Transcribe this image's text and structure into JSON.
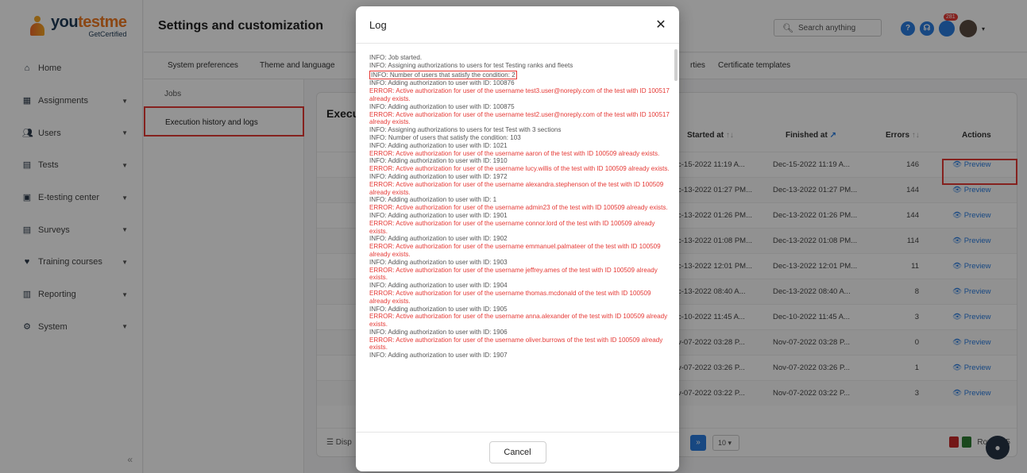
{
  "logo": {
    "name_main_a": "you",
    "name_main_b": "testme",
    "tagline": "GetCertified"
  },
  "sidebar": {
    "items": [
      {
        "label": "Home",
        "icon": "home-icon",
        "expandable": false
      },
      {
        "label": "Assignments",
        "icon": "assignments-icon",
        "expandable": true
      },
      {
        "label": "Users",
        "icon": "users-icon",
        "expandable": true
      },
      {
        "label": "Tests",
        "icon": "tests-icon",
        "expandable": true
      },
      {
        "label": "E-testing center",
        "icon": "e-testing-icon",
        "expandable": true
      },
      {
        "label": "Surveys",
        "icon": "surveys-icon",
        "expandable": true
      },
      {
        "label": "Training courses",
        "icon": "training-icon",
        "expandable": true
      },
      {
        "label": "Reporting",
        "icon": "reporting-icon",
        "expandable": true
      },
      {
        "label": "System",
        "icon": "gear-icon",
        "expandable": true
      }
    ],
    "collapse_glyph": "«"
  },
  "header": {
    "title": "Settings and customization",
    "search_placeholder": "Search anything",
    "notification_count": "281"
  },
  "subnav": {
    "tabs": [
      "System preferences",
      "Theme and language",
      "rties",
      "Certificate templates"
    ]
  },
  "left_menu": {
    "jobs": "Jobs",
    "selected": "Execution history and logs"
  },
  "table": {
    "title": "Execu",
    "columns": {
      "started": "Started at",
      "finished": "Finished at",
      "errors": "Errors",
      "actions": "Actions"
    },
    "rows": [
      {
        "started": "c-15-2022 11:19 A...",
        "finished": "Dec-15-2022 11:19 A...",
        "errors": "146",
        "action": "Preview"
      },
      {
        "started": "c-13-2022 01:27 PM...",
        "finished": "Dec-13-2022 01:27 PM...",
        "errors": "144",
        "action": "Preview"
      },
      {
        "started": "c-13-2022 01:26 PM...",
        "finished": "Dec-13-2022 01:26 PM...",
        "errors": "144",
        "action": "Preview"
      },
      {
        "started": "c-13-2022 01:08 PM...",
        "finished": "Dec-13-2022 01:08 PM...",
        "errors": "114",
        "action": "Preview"
      },
      {
        "started": "c-13-2022 12:01 PM...",
        "finished": "Dec-13-2022 12:01 PM...",
        "errors": "11",
        "action": "Preview"
      },
      {
        "started": "c-13-2022 08:40 A...",
        "finished": "Dec-13-2022 08:40 A...",
        "errors": "8",
        "action": "Preview"
      },
      {
        "started": "c-10-2022 11:45 A...",
        "finished": "Dec-10-2022 11:45 A...",
        "errors": "3",
        "action": "Preview"
      },
      {
        "started": "v-07-2022 03:28 P...",
        "finished": "Nov-07-2022 03:28 P...",
        "errors": "0",
        "action": "Preview"
      },
      {
        "started": "v-07-2022 03:26 P...",
        "finished": "Nov-07-2022 03:26 P...",
        "errors": "1",
        "action": "Preview"
      },
      {
        "started": "v-07-2022 03:22 P...",
        "finished": "Nov-07-2022 03:22 P...",
        "errors": "3",
        "action": "Preview"
      }
    ],
    "footer": {
      "display_prefix": "Disp",
      "page_size": "10",
      "rows_label": "Rows: 15"
    }
  },
  "modal": {
    "title": "Log",
    "cancel_label": "Cancel",
    "lines": [
      {
        "type": "info",
        "text": "INFO: Job started."
      },
      {
        "type": "info",
        "text": "INFO: Assigning authorizations to users for test Testing ranks and fleets"
      },
      {
        "type": "info",
        "text": "INFO: Number of users that satisfy the condition: 2",
        "highlight": true
      },
      {
        "type": "info",
        "text": "INFO: Adding authorization to user with ID: 100876"
      },
      {
        "type": "error",
        "text": "ERROR: Active authorization for user of the username test3.user@noreply.com of the test with ID 100517 already exists."
      },
      {
        "type": "info",
        "text": "INFO: Adding authorization to user with ID: 100875"
      },
      {
        "type": "error",
        "text": "ERROR: Active authorization for user of the username test2.user@noreply.com of the test with ID 100517 already exists."
      },
      {
        "type": "info",
        "text": "INFO: Assigning authorizations to users for test Test with 3 sections"
      },
      {
        "type": "info",
        "text": "INFO: Number of users that satisfy the condition: 103"
      },
      {
        "type": "info",
        "text": "INFO: Adding authorization to user with ID: 1021"
      },
      {
        "type": "error",
        "text": "ERROR: Active authorization for user of the username aaron of the test with ID 100509 already exists."
      },
      {
        "type": "info",
        "text": "INFO: Adding authorization to user with ID: 1910"
      },
      {
        "type": "error",
        "text": "ERROR: Active authorization for user of the username lucy.willis of the test with ID 100509 already exists."
      },
      {
        "type": "info",
        "text": "INFO: Adding authorization to user with ID: 1972"
      },
      {
        "type": "error",
        "text": "ERROR: Active authorization for user of the username alexandra.stephenson of the test with ID 100509 already exists."
      },
      {
        "type": "info",
        "text": "INFO: Adding authorization to user with ID: 1"
      },
      {
        "type": "error",
        "text": "ERROR: Active authorization for user of the username admin23 of the test with ID 100509 already exists."
      },
      {
        "type": "info",
        "text": "INFO: Adding authorization to user with ID: 1901"
      },
      {
        "type": "error",
        "text": "ERROR: Active authorization for user of the username connor.lord of the test with ID 100509 already exists."
      },
      {
        "type": "info",
        "text": "INFO: Adding authorization to user with ID: 1902"
      },
      {
        "type": "error",
        "text": "ERROR: Active authorization for user of the username emmanuel.palmateer of the test with ID 100509 already exists."
      },
      {
        "type": "info",
        "text": "INFO: Adding authorization to user with ID: 1903"
      },
      {
        "type": "error",
        "text": "ERROR: Active authorization for user of the username jeffrey.ames of the test with ID 100509 already exists."
      },
      {
        "type": "info",
        "text": "INFO: Adding authorization to user with ID: 1904"
      },
      {
        "type": "error",
        "text": "ERROR: Active authorization for user of the username thomas.mcdonald of the test with ID 100509 already exists."
      },
      {
        "type": "info",
        "text": "INFO: Adding authorization to user with ID: 1905"
      },
      {
        "type": "error",
        "text": "ERROR: Active authorization for user of the username anna.alexander of the test with ID 100509 already exists."
      },
      {
        "type": "info",
        "text": "INFO: Adding authorization to user with ID: 1906"
      },
      {
        "type": "error",
        "text": "ERROR: Active authorization for user of the username oliver.burrows of the test with ID 100509 already exists."
      },
      {
        "type": "info",
        "text": "INFO: Adding authorization to user with ID: 1907"
      }
    ]
  },
  "colors": {
    "accent": "#2a7de1",
    "error": "#e53935",
    "brand_orange": "#f07a24",
    "brand_navy": "#1f3b57"
  }
}
